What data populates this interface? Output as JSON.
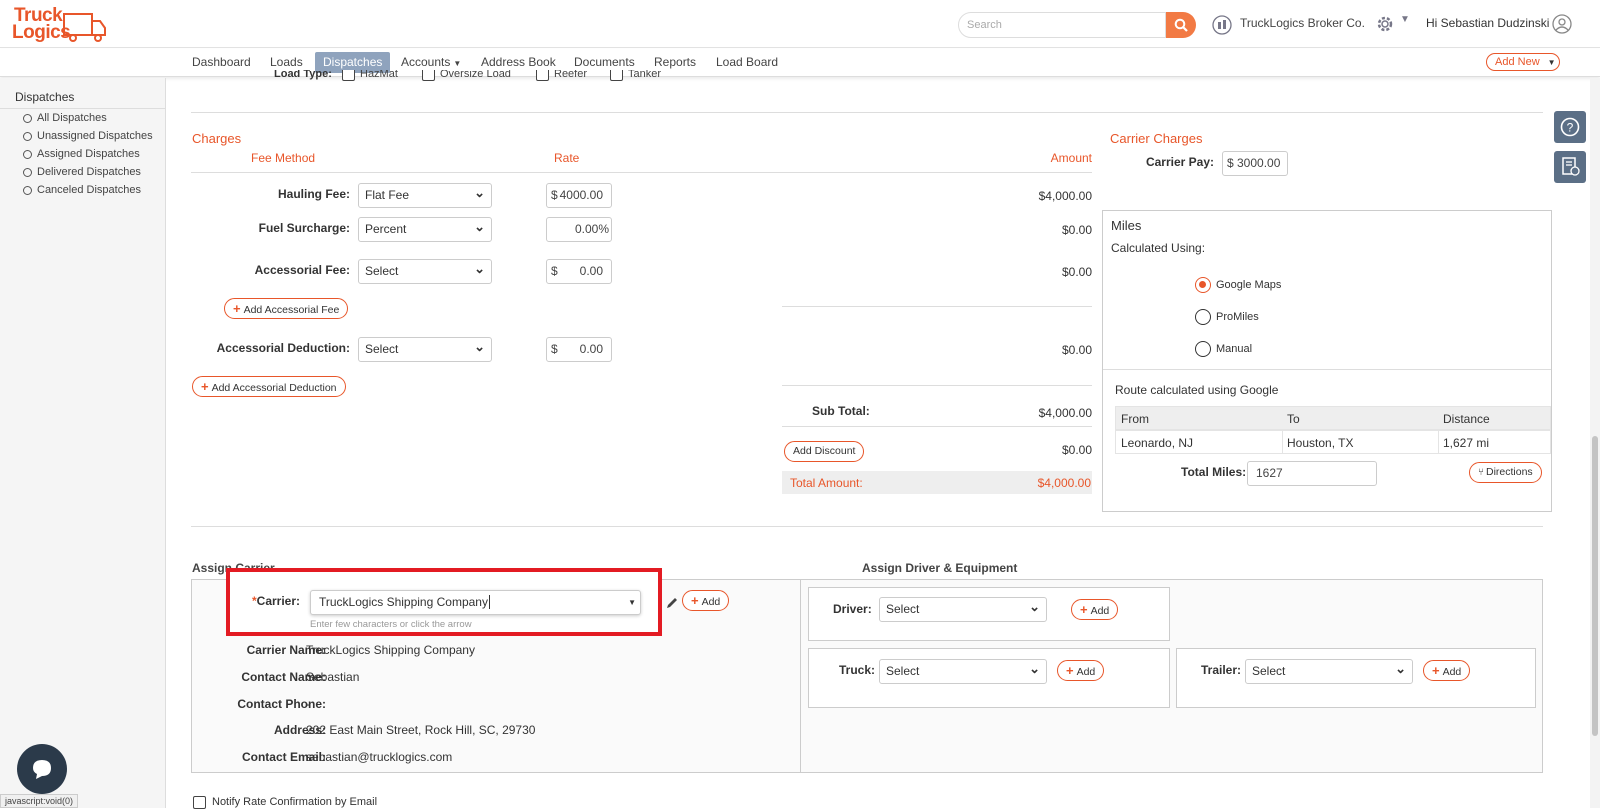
{
  "header": {
    "logo_top": "Truck",
    "logo_bottom": "Logics",
    "search_placeholder": "Search",
    "company": "TruckLogics Broker Co.",
    "greeting": "Hi Sebastian Dudzinski"
  },
  "nav": {
    "items": [
      "Dashboard",
      "Loads",
      "Dispatches",
      "Accounts",
      "Address Book",
      "Documents",
      "Reports",
      "Load Board"
    ],
    "active": "Dispatches",
    "add_new": "Add New"
  },
  "sidebar": {
    "title": "Dispatches",
    "items": [
      "All Dispatches",
      "Unassigned Dispatches",
      "Assigned Dispatches",
      "Delivered Dispatches",
      "Canceled Dispatches"
    ]
  },
  "load_type": {
    "label": "Load Type:",
    "options": [
      "HazMat",
      "Oversize Load",
      "Reefer",
      "Tanker"
    ]
  },
  "charges": {
    "title": "Charges",
    "col_fee_method": "Fee Method",
    "col_rate": "Rate",
    "col_amount": "Amount",
    "rows": [
      {
        "label": "Hauling Fee:",
        "method": "Flat Fee",
        "rate_prefix": "$",
        "rate": "4000.00",
        "amount": "$4,000.00"
      },
      {
        "label": "Fuel Surcharge:",
        "method": "Percent",
        "rate_prefix": "",
        "rate": "0.00%",
        "amount": "$0.00"
      },
      {
        "label": "Accessorial Fee:",
        "method": "Select",
        "rate_prefix": "$",
        "rate": "0.00",
        "amount": "$0.00"
      },
      {
        "label": "Accessorial Deduction:",
        "method": "Select",
        "rate_prefix": "$",
        "rate": "0.00",
        "amount": "$0.00"
      }
    ],
    "add_accessorial_fee": "Add Accessorial Fee",
    "add_accessorial_deduction": "Add Accessorial Deduction",
    "sub_total_label": "Sub Total:",
    "sub_total": "$4,000.00",
    "add_discount": "Add Discount",
    "discount": "$0.00",
    "total_label": "Total Amount:",
    "total": "$4,000.00"
  },
  "carrier_charges": {
    "title": "Carrier Charges",
    "pay_label": "Carrier Pay:",
    "pay_prefix": "$",
    "pay_value": "3000.00"
  },
  "miles": {
    "title": "Miles",
    "calc_label": "Calculated Using:",
    "options": [
      "Google Maps",
      "ProMiles",
      "Manual"
    ],
    "selected": "Google Maps",
    "route_text": "Route calculated using Google",
    "table_headers": [
      "From",
      "To",
      "Distance"
    ],
    "table_row": [
      "Leonardo, NJ",
      "Houston, TX",
      "1,627 mi"
    ],
    "total_label": "Total Miles:",
    "total_value": "1627",
    "directions": "Directions"
  },
  "assign_carrier": {
    "title": "Assign Carrier",
    "carrier_label": "Carrier:",
    "carrier_required": "*",
    "carrier_value": "TruckLogics Shipping Company",
    "carrier_hint": "Enter few characters or click the arrow",
    "add": "Add",
    "info": [
      {
        "label": "Carrier Name:",
        "value": "TruckLogics Shipping Company"
      },
      {
        "label": "Contact Name:",
        "value": "Sebastian"
      },
      {
        "label": "Contact Phone:",
        "value": "-"
      },
      {
        "label": "Address:",
        "value": "202 East Main Street, Rock Hill, SC, 29730"
      },
      {
        "label": "Contact Email:",
        "value": "sebastian@trucklogics.com"
      }
    ]
  },
  "assign_driver": {
    "title": "Assign Driver & Equipment",
    "driver_label": "Driver:",
    "truck_label": "Truck:",
    "trailer_label": "Trailer:",
    "select": "Select",
    "add": "Add"
  },
  "notify": {
    "label": "Notify Rate Confirmation by Email"
  },
  "status_bar": {
    "text": "javascript:void(0)"
  },
  "colors": {
    "accent": "#e8562a",
    "nav_active": "#8fa3bd",
    "tool": "#5b6f86",
    "highlight": "#e31b23"
  }
}
